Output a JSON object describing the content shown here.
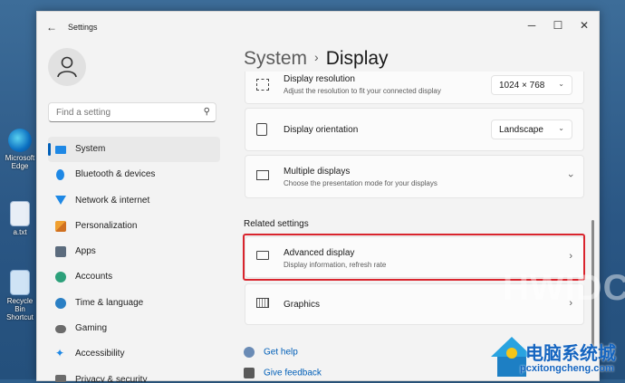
{
  "window": {
    "title": "Settings",
    "back_icon": "back-arrow-icon",
    "minimize": "─",
    "maximize": "☐",
    "close": "✕"
  },
  "search": {
    "placeholder": "Find a setting"
  },
  "sidebar": {
    "items": [
      {
        "label": "System",
        "icon": "system-icon",
        "active": true
      },
      {
        "label": "Bluetooth & devices",
        "icon": "bluetooth-icon"
      },
      {
        "label": "Network & internet",
        "icon": "wifi-icon"
      },
      {
        "label": "Personalization",
        "icon": "brush-icon"
      },
      {
        "label": "Apps",
        "icon": "apps-icon"
      },
      {
        "label": "Accounts",
        "icon": "accounts-icon"
      },
      {
        "label": "Time & language",
        "icon": "globe-clock-icon"
      },
      {
        "label": "Gaming",
        "icon": "gaming-icon"
      },
      {
        "label": "Accessibility",
        "icon": "accessibility-icon"
      },
      {
        "label": "Privacy & security",
        "icon": "shield-icon"
      }
    ]
  },
  "header": {
    "crumb": "System",
    "separator": "›",
    "title": "Display"
  },
  "cards": {
    "resolution": {
      "title": "Display resolution",
      "subtitle": "Adjust the resolution to fit your connected display",
      "value": "1024 × 768"
    },
    "orientation": {
      "title": "Display orientation",
      "value": "Landscape"
    },
    "multiple": {
      "title": "Multiple displays",
      "subtitle": "Choose the presentation mode for your displays"
    }
  },
  "related": {
    "heading": "Related settings",
    "advanced": {
      "title": "Advanced display",
      "subtitle": "Display information, refresh rate"
    },
    "graphics": {
      "title": "Graphics"
    }
  },
  "links": {
    "help": "Get help",
    "feedback": "Give feedback"
  },
  "desktop": {
    "icons": [
      {
        "label": "Microsoft Edge"
      },
      {
        "label": "a.txt"
      },
      {
        "label": "Recycle Bin Shortcut"
      }
    ]
  },
  "watermark": {
    "brand": "HWIDC",
    "site_cn": "电脑系统城",
    "site_url": "pcxitongcheng.com"
  },
  "colors": {
    "accent": "#005fb8",
    "highlight": "#d9242d",
    "window_bg": "#f3f3f3"
  }
}
